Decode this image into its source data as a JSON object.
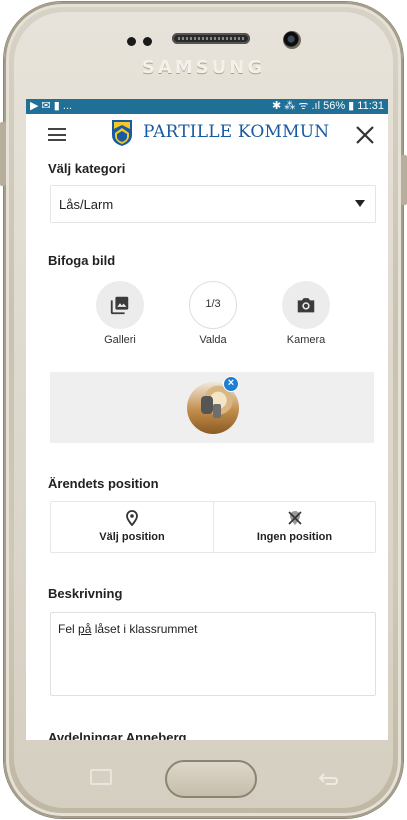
{
  "device": {
    "brand": "SAMSUNG"
  },
  "statusbar": {
    "left_icons": "▶ ✉ ▮ ...",
    "right_icons": "✱ ✈ ☰ ⁄ 56% ▮",
    "battery_percent": "56%",
    "time": "11:31"
  },
  "appbar": {
    "logo_text": "PARTILLE KOMMUN",
    "menu_icon": "hamburger-icon",
    "close_icon": "close-icon"
  },
  "category": {
    "label": "Välj kategori",
    "selected": "Lås/Larm"
  },
  "attach": {
    "label": "Bifoga bild",
    "options": [
      {
        "label": "Galleri",
        "icon": "gallery-icon"
      },
      {
        "label": "Valda",
        "counter": "1/3"
      },
      {
        "label": "Kamera",
        "icon": "camera-icon"
      }
    ],
    "remove_badge": "×"
  },
  "position": {
    "label": "Ärendets position",
    "choose": "Välj position",
    "none": "Ingen position"
  },
  "description": {
    "label": "Beskrivning",
    "value_parts": [
      "Fel ",
      "på",
      " låset i klassrummet"
    ]
  },
  "next_section": {
    "label": "Avdelningar Anneberg"
  },
  "colors": {
    "statusbar": "#1f6f97",
    "brand_blue": "#1a5aa0",
    "badge_blue": "#1f7fd3"
  }
}
